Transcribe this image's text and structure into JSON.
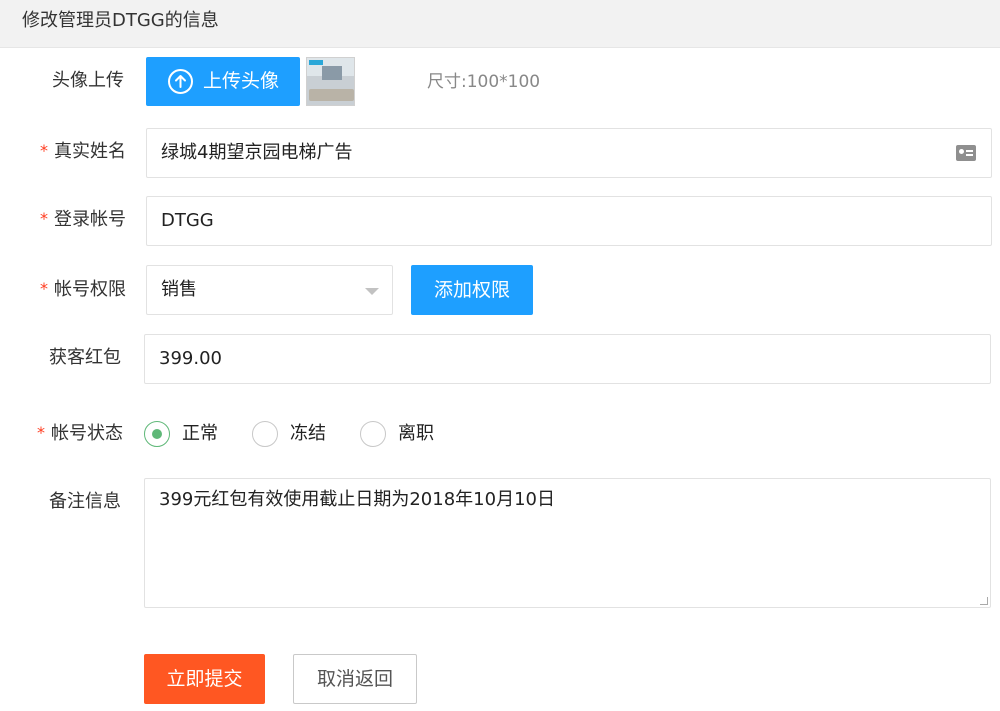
{
  "header": {
    "title": "修改管理员DTGG的信息"
  },
  "avatar": {
    "label": "头像上传",
    "upload_button": "上传头像",
    "size_hint": "尺寸:100*100"
  },
  "real_name": {
    "required_mark": "*",
    "label": "真实姓名",
    "value": "绿城4期望京园电梯广告"
  },
  "login_account": {
    "required_mark": "*",
    "label": "登录帐号",
    "value": "DTGG"
  },
  "permission": {
    "required_mark": "*",
    "label": "帐号权限",
    "selected": "销售",
    "add_button": "添加权限"
  },
  "red_packet": {
    "label": "获客红包",
    "value": "399.00"
  },
  "account_status": {
    "required_mark": "*",
    "label": "帐号状态",
    "options": [
      "正常",
      "冻结",
      "离职"
    ],
    "selected_index": 0
  },
  "notes": {
    "label": "备注信息",
    "value": "399元红包有效使用截止日期为2018年10月10日"
  },
  "actions": {
    "submit": "立即提交",
    "cancel": "取消返回"
  },
  "colors": {
    "primary": "#1e9fff",
    "danger": "#ff5722",
    "radio_checked": "#5fb878",
    "required": "#ff3b1f"
  }
}
